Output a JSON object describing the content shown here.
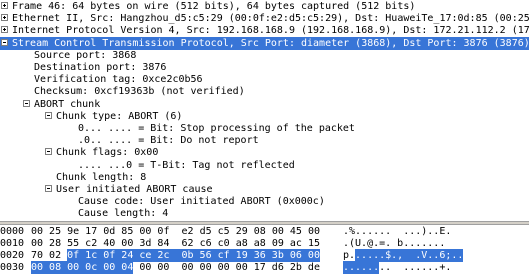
{
  "tree": [
    {
      "text": "Frame 46: 64 bytes on wire (512 bits), 64 bytes captured (512 bits)",
      "expander": "plus",
      "selected": false
    },
    {
      "text": "Ethernet II, Src: Hangzhou_d5:c5:29 (00:0f:e2:d5:c5:29), Dst: HuaweiTe_17:0d:85 (00:25",
      "expander": "plus",
      "selected": false
    },
    {
      "text": "Internet Protocol Version 4, Src: 192.168.168.9 (192.168.168.9), Dst: 172.21.112.2 (17",
      "expander": "plus",
      "selected": false
    },
    {
      "text": "Stream Control Transmission Protocol, Src Port: diameter (3868), Dst Port: 3876 (3876)",
      "expander": "minus",
      "selected": true
    },
    {
      "text": "Source port: 3868",
      "expander": "",
      "selected": false
    },
    {
      "text": "Destination port: 3876",
      "expander": "",
      "selected": false
    },
    {
      "text": "Verification tag: 0xce2c0b56",
      "expander": "",
      "selected": false
    },
    {
      "text": "Checksum: 0xcf19363b (not verified)",
      "expander": "",
      "selected": false
    },
    {
      "text": "ABORT chunk",
      "expander": "minus",
      "selected": false
    },
    {
      "text": "Chunk type: ABORT (6)",
      "expander": "minus",
      "selected": false
    },
    {
      "text": "0... .... = Bit: Stop processing of the packet",
      "expander": "",
      "selected": false
    },
    {
      "text": ".0.. .... = Bit: Do not report",
      "expander": "",
      "selected": false
    },
    {
      "text": "Chunk flags: 0x00",
      "expander": "minus",
      "selected": false
    },
    {
      "text": ".... ...0 = T-Bit: Tag not reflected",
      "expander": "",
      "selected": false
    },
    {
      "text": "Chunk length: 8",
      "expander": "",
      "selected": false
    },
    {
      "text": "User initiated ABORT cause",
      "expander": "minus",
      "selected": false
    },
    {
      "text": "Cause code: User initiated ABORT (0x000c)",
      "expander": "",
      "selected": false
    },
    {
      "text": "Cause length: 4",
      "expander": "",
      "selected": false
    }
  ],
  "hex": [
    {
      "offset": "0000",
      "bytes_plain": "00 25 9e 17 0d 85 00 0f  e2 d5 c5 29 08 00 45 00",
      "bytes_hl": "",
      "bytes_tail": "",
      "ascii_plain": ".%......  ...)..E.",
      "ascii_hl": "",
      "ascii_tail": ""
    },
    {
      "offset": "0010",
      "bytes_plain": "00 28 55 c2 40 00 3d 84  62 c6 c0 a8 a8 09 ac 15",
      "bytes_hl": "",
      "bytes_tail": "",
      "ascii_plain": ".(U.@.=. b.......",
      "ascii_hl": "",
      "ascii_tail": ""
    },
    {
      "offset": "0020",
      "bytes_plain": "70 02 ",
      "bytes_hl": "0f 1c 0f 24 ce 2c  0b 56 cf 19 36 3b 06 00",
      "bytes_tail": "",
      "ascii_plain": "p.",
      "ascii_hl": ".....$.,  .V..6;..",
      "ascii_tail": ""
    },
    {
      "offset": "0030",
      "bytes_plain": "",
      "bytes_hl": "00 08 00 0c 00 04",
      "bytes_tail": " 00 00  00 00 00 00 17 d6 2b de",
      "ascii_plain": "",
      "ascii_hl": "......",
      "ascii_tail": "..  ......+."
    }
  ]
}
